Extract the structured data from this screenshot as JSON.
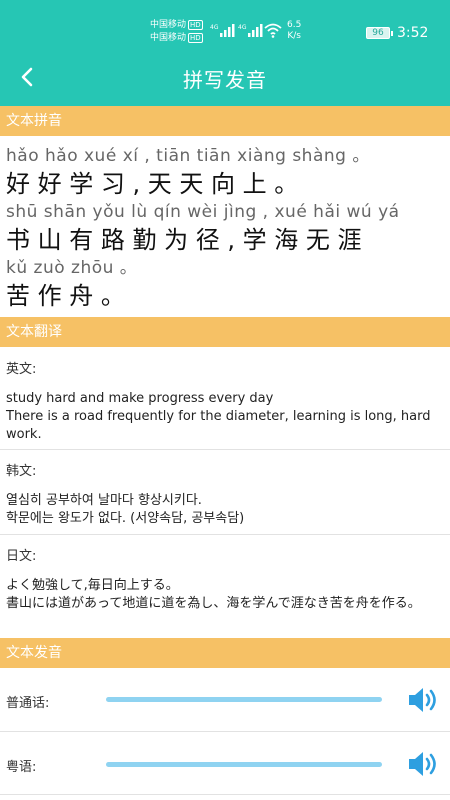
{
  "status_bar": {
    "carrier_1": "中国移动",
    "carrier_2": "中国移动",
    "hd_badge": "HD",
    "speed_value": "6.5",
    "speed_unit": "K/s",
    "battery": "96",
    "time": "3:52"
  },
  "app_bar": {
    "title": "拼写发音",
    "back_icon": "chevron-left-icon"
  },
  "sections": {
    "pinyin": "文本拼音",
    "translation": "文本翻译",
    "pronunciation": "文本发音"
  },
  "pinyin_lines": [
    {
      "pinyin": "hǎo hǎo xué  xí  ,   tiān tiān xiàng shàng  。",
      "hanzi": "好 好 学 习 ,  天 天  向   上  。"
    },
    {
      "pinyin": "shū shān yǒu  lù  qín wèi jìng  ,   xué hǎi wú yá",
      "hanzi": "书  山  有 路 勤 为 径 ,  学 海 无 涯"
    },
    {
      "pinyin": "kǔ zuò zhōu  。",
      "hanzi": "苦 作  舟  。"
    }
  ],
  "translations": [
    {
      "label": "英文:",
      "text": "study hard and make progress every day\nThere is a road frequently for the diameter, learning is long, hard work."
    },
    {
      "label": "韩文:",
      "text": "열심히 공부하여 날마다 향상시키다.\n학문에는 왕도가 없다. (서양속담, 공부속담)"
    },
    {
      "label": "日文:",
      "text": "よく勉強して,毎日向上する。\n書山には道があって地道に道を為し、海を学んで涯なき苦を舟を作る。"
    }
  ],
  "audio": [
    {
      "label": "普通话:",
      "icon": "speaker-icon"
    },
    {
      "label": "粤语:",
      "icon": "speaker-icon"
    }
  ],
  "colors": {
    "primary": "#26c6b4",
    "section_header": "#f6c165",
    "audio_bar": "#8fd3f1",
    "speaker": "#2e9fe0"
  }
}
